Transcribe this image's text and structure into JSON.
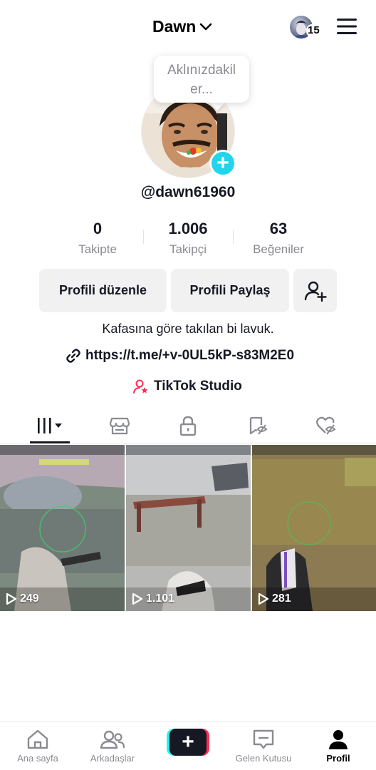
{
  "header": {
    "username": "Dawn",
    "account_badge_count": "15"
  },
  "profile": {
    "note_bubble": "Aklınızdakiler...",
    "note_bubble_line1": "Aklınızdakil",
    "note_bubble_line2": "er...",
    "handle": "@dawn61960",
    "bio": "Kafasına göre takılan bi lavuk.",
    "link": "https://t.me/+v-0UL5kP-s83M2E0",
    "studio_label": "TikTok Studio"
  },
  "stats": [
    {
      "value": "0",
      "label": "Takipte"
    },
    {
      "value": "1.006",
      "label": "Takipçi"
    },
    {
      "value": "63",
      "label": "Beğeniler"
    }
  ],
  "actions": {
    "edit_profile": "Profili düzenle",
    "share_profile": "Profili Paylaş"
  },
  "tabs": [
    {
      "name": "videos",
      "icon": "grid-icon",
      "active": true
    },
    {
      "name": "shop",
      "icon": "store-icon"
    },
    {
      "name": "private",
      "icon": "lock-icon"
    },
    {
      "name": "reposts",
      "icon": "bookmark-hidden-icon"
    },
    {
      "name": "liked",
      "icon": "heart-hidden-icon"
    }
  ],
  "videos": [
    {
      "views": "249"
    },
    {
      "views": "1.101"
    },
    {
      "views": "281"
    }
  ],
  "bottom_nav": [
    {
      "label": "Ana sayfa",
      "icon": "home-icon"
    },
    {
      "label": "Arkadaşlar",
      "icon": "friends-icon"
    },
    {
      "label": "",
      "icon": "plus-icon"
    },
    {
      "label": "Gelen Kutusu",
      "icon": "inbox-icon"
    },
    {
      "label": "Profil",
      "icon": "profile-icon",
      "active": true
    }
  ],
  "colors": {
    "accent_cyan": "#20d5ec",
    "tiktok_cyan": "#25f4ee",
    "tiktok_red": "#fe2c55",
    "text_primary": "#161823",
    "text_secondary": "#8a8b91",
    "button_bg": "#f1f1f2"
  }
}
